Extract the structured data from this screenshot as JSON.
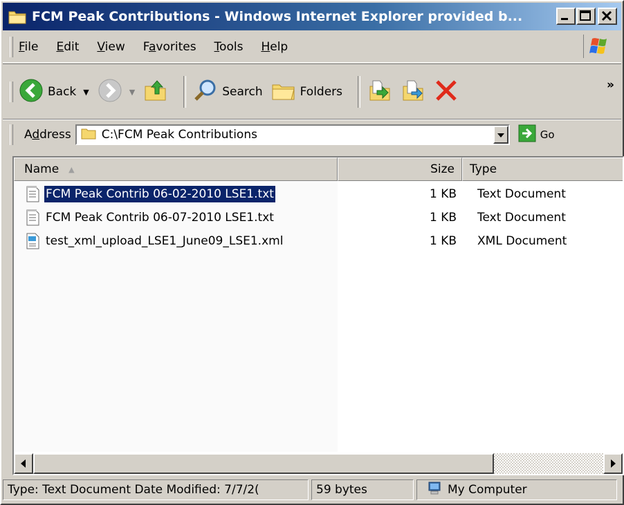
{
  "window": {
    "title": "FCM Peak Contributions - Windows Internet Explorer provided b..."
  },
  "menu": {
    "items": [
      {
        "label": "File",
        "key": "F",
        "rest": "ile"
      },
      {
        "label": "Edit",
        "key": "E",
        "rest": "dit"
      },
      {
        "label": "View",
        "key": "V",
        "rest": "iew"
      },
      {
        "label": "Favorites",
        "pre": "F",
        "key": "a",
        "rest": "vorites"
      },
      {
        "label": "Tools",
        "key": "T",
        "rest": "ools"
      },
      {
        "label": "Help",
        "key": "H",
        "rest": "elp"
      }
    ]
  },
  "toolbar": {
    "back_label": "Back",
    "search_label": "Search",
    "folders_label": "Folders",
    "more_label": "»"
  },
  "address": {
    "label_pre": "A",
    "label_key": "d",
    "label_rest": "dress",
    "value": "C:\\FCM Peak Contributions",
    "go_label": "Go"
  },
  "list": {
    "columns": {
      "name": "Name",
      "size": "Size",
      "type": "Type"
    },
    "rows": [
      {
        "name": "FCM Peak Contrib 06-02-2010 LSE1.txt",
        "size": "1 KB",
        "type": "Text Document",
        "icon": "text-file-icon",
        "selected": true
      },
      {
        "name": "FCM Peak Contrib 06-07-2010 LSE1.txt",
        "size": "1 KB",
        "type": "Text Document",
        "icon": "text-file-icon",
        "selected": false
      },
      {
        "name": "test_xml_upload_LSE1_June09_LSE1.xml",
        "size": "1 KB",
        "type": "XML Document",
        "icon": "xml-file-icon",
        "selected": false
      }
    ]
  },
  "status": {
    "info": "Type: Text Document Date Modified: 7/7/2(",
    "size": "59 bytes",
    "zone": "My Computer"
  },
  "colors": {
    "title_gradient_start": "#0a246a",
    "selection": "#0a246a",
    "face": "#d4d0c8"
  }
}
